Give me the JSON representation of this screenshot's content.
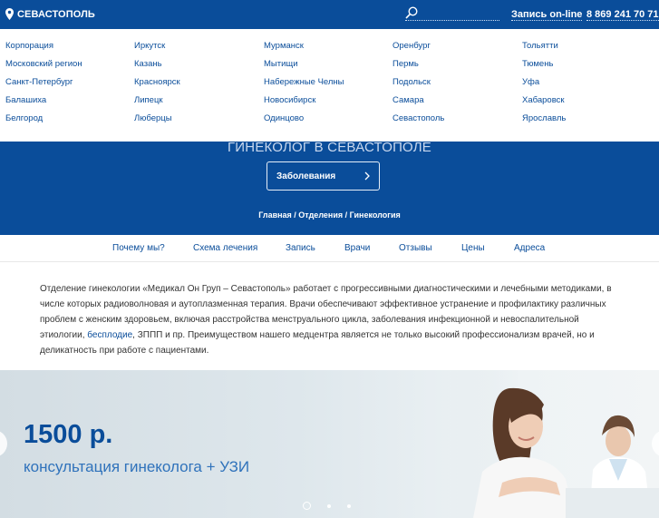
{
  "topbar": {
    "city": "СЕВАСТОПОЛЬ",
    "search_value": "",
    "online_label": "Запись on-line",
    "phone": "8 869 241 70 71"
  },
  "city_dropdown": {
    "columns": [
      [
        "Корпорация",
        "Московский регион",
        "Санкт-Петербург",
        "Балашиха",
        "Белгород"
      ],
      [
        "Иркутск",
        "Казань",
        "Красноярск",
        "Липецк",
        "Люберцы"
      ],
      [
        "Мурманск",
        "Мытищи",
        "Набережные Челны",
        "Новосибирск",
        "Одинцово"
      ],
      [
        "Оренбург",
        "Пермь",
        "Подольск",
        "Самара",
        "Севастополь"
      ],
      [
        "Тольятти",
        "Тюмень",
        "Уфа",
        "Хабаровск",
        "Ярославль"
      ]
    ]
  },
  "hero": {
    "title": "ГИНЕКОЛОГ В СЕВАСТОПОЛЕ",
    "button_label": "Заболевания",
    "breadcrumb": "Главная / Отделения / Гинекология"
  },
  "tabs": [
    "Почему мы?",
    "Схема лечения",
    "Запись",
    "Врачи",
    "Отзывы",
    "Цены",
    "Адреса"
  ],
  "intro": {
    "part1": "Отделение гинекологии «Медикал Он Груп – Севастополь» работает с прогрессивными диагностическими и лечебными методиками, в числе которых радиоволновая и аутоплазменная терапия. Врачи обеспечивают эффективное устранение и профилактику различных проблем с женским здоровьем, включая расстройства менструального цикла, заболевания инфекционной и невоспалительной этиологии, ",
    "link": "бесплодие",
    "part2": ", ЗППП и пр. Преимуществом нашего медцентра является не только высокий профессионализм врачей, но и деликатность при работе с пациентами."
  },
  "promo": {
    "price": "1500 р.",
    "subtitle": "консультация гинеколога + УЗИ",
    "slides_total": 3,
    "active_slide": 1
  },
  "colors": {
    "brand_blue": "#0a4d9a",
    "link_blue": "#0a4d9a",
    "promo_subtitle": "#2f72bb"
  }
}
